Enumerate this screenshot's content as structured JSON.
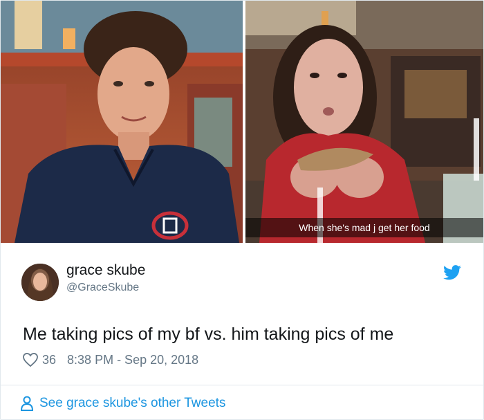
{
  "media": {
    "left_photo_alt": "boyfriend-photo",
    "right_photo_caption": "When she's mad j get her food"
  },
  "tweet": {
    "display_name": "grace skube",
    "handle": "@GraceSkube",
    "text": "Me taking pics of my bf vs. him taking pics of me",
    "like_count": "36",
    "timestamp": "8:38 PM - Sep 20, 2018"
  },
  "footer": {
    "link_label": "See grace skube's other Tweets"
  },
  "colors": {
    "twitter_blue": "#1b95e0",
    "secondary_text": "#657786",
    "border": "#e1e8ed"
  },
  "icons": [
    "twitter-bird-icon",
    "heart-icon",
    "person-icon"
  ]
}
